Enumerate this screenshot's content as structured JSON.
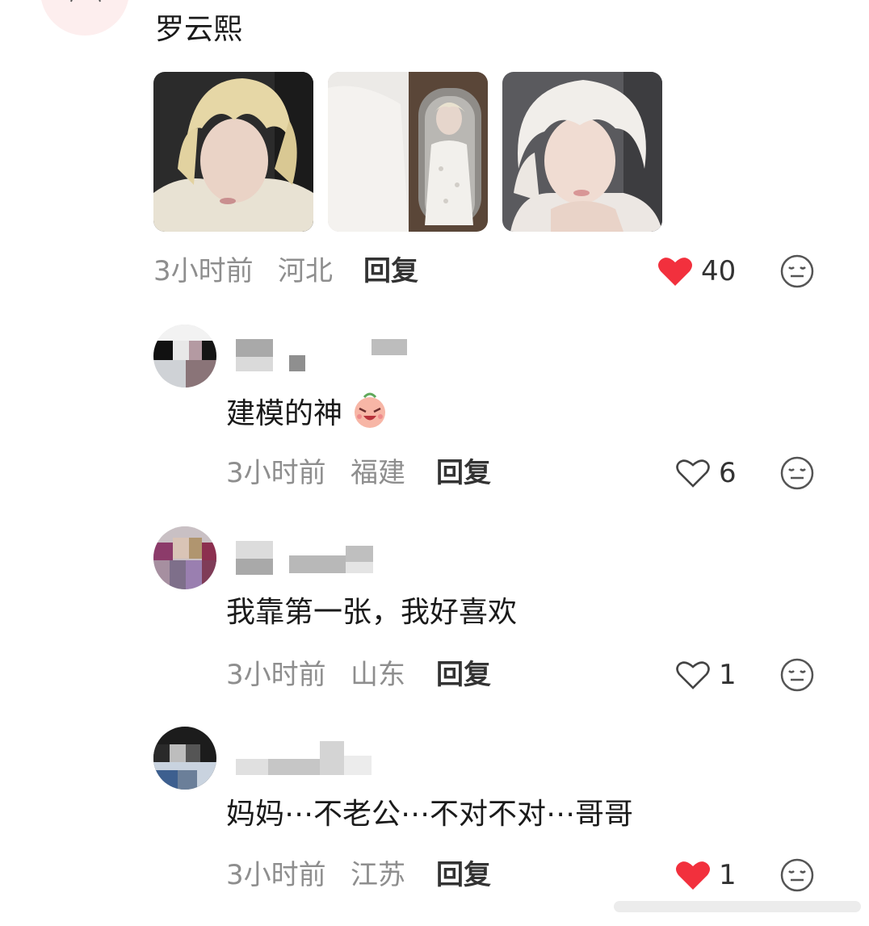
{
  "main_comment": {
    "text": "罗云熙",
    "time": "3小时前",
    "location": "河北",
    "reply_label": "回复",
    "likes": "40",
    "liked": true
  },
  "sub_comments": [
    {
      "text": "建模的神",
      "emoji": "laughing-face-emoji",
      "time": "3小时前",
      "location": "福建",
      "reply_label": "回复",
      "likes": "6",
      "liked": false
    },
    {
      "text": "我靠第一张，我好喜欢",
      "time": "3小时前",
      "location": "山东",
      "reply_label": "回复",
      "likes": "1",
      "liked": false
    },
    {
      "text": "妈妈⋯不老公⋯不对不对⋯哥哥",
      "time": "3小时前",
      "location": "江苏",
      "reply_label": "回复",
      "likes": "1",
      "liked": true
    }
  ],
  "icons": {
    "like_filled": "heart-filled-icon",
    "like_outline": "heart-outline-icon",
    "dislike": "neutral-face-icon"
  },
  "colors": {
    "like_active": "#f2303d",
    "meta_text": "#8e8e8e",
    "reply_text": "#333333"
  }
}
